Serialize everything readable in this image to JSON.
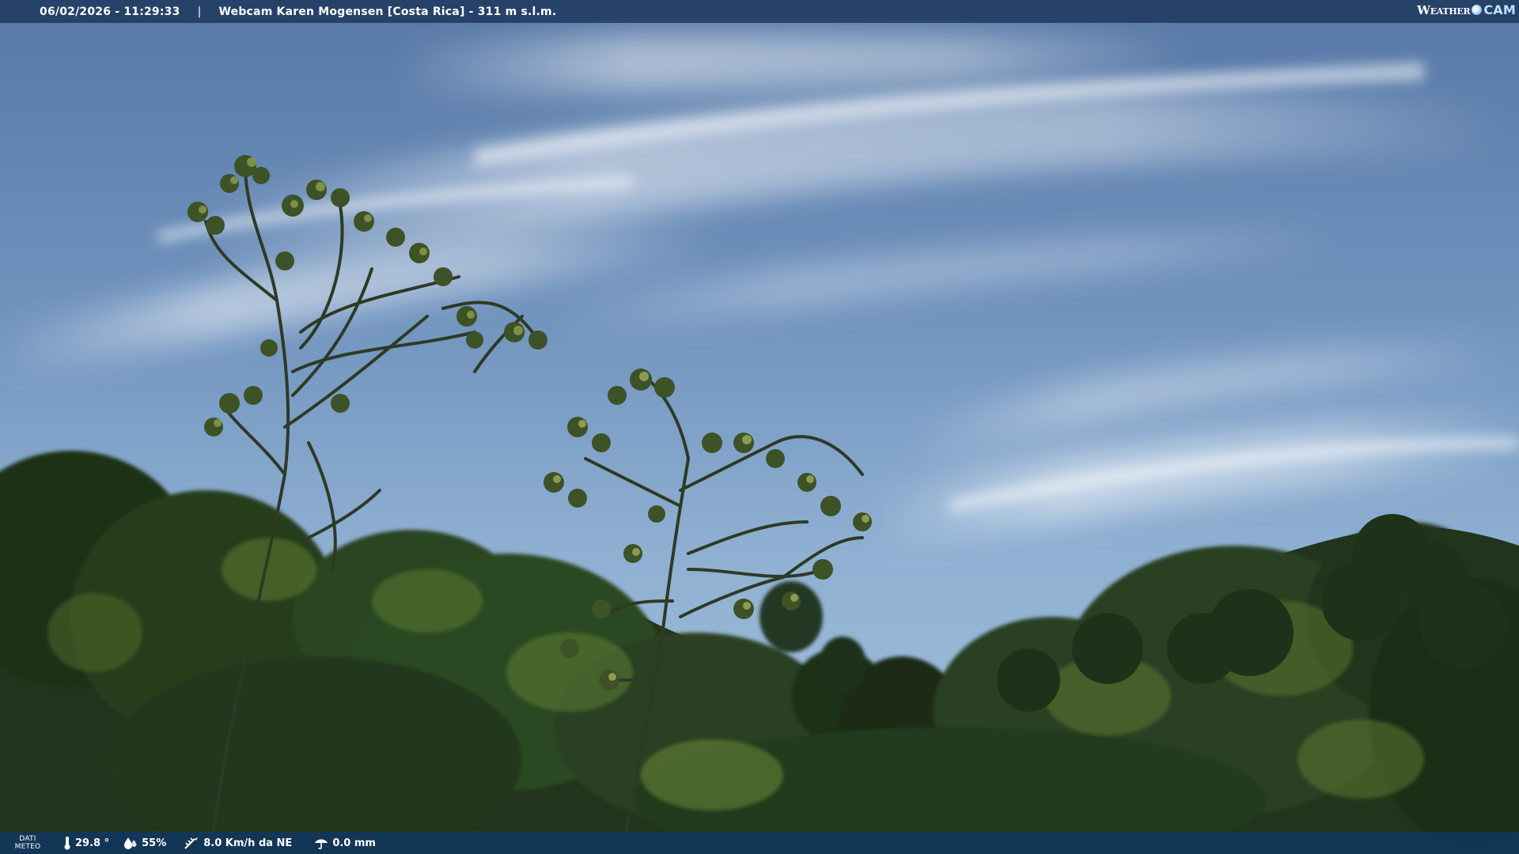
{
  "header": {
    "timestamp": "06/02/2026 - 11:29:33",
    "separator": "|",
    "title": "Webcam Karen Mogensen [Costa Rica]  - 311 m s.l.m.",
    "brand_left": "Weather",
    "brand_right": "CAM"
  },
  "footer": {
    "label_line1": "DATI",
    "label_line2": "METEO",
    "temperature": "29.8 °",
    "humidity": "55%",
    "wind": "8.0 Km/h da NE",
    "rain": "0.0 mm",
    "icons": [
      "thermometer-icon",
      "humidity-drop-icon",
      "wind-icon",
      "rain-gauge-icon"
    ]
  },
  "colors": {
    "bar_top": "#1c365c",
    "bar_bottom": "#103660",
    "sky_top": "#5a7fae",
    "sky_bottom": "#a9c3dd",
    "foliage_dark": "#1b2e18",
    "foliage_light": "#6e8a3a"
  }
}
